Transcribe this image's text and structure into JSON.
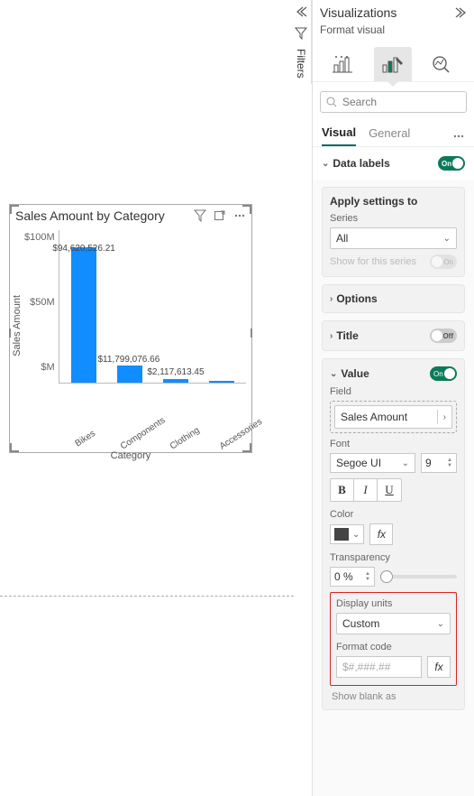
{
  "filters": {
    "label": "Filters"
  },
  "chart": {
    "title": "Sales Amount by Category",
    "y_ticks": [
      "$100M",
      "$50M",
      "$M"
    ],
    "y_label": "Sales Amount",
    "x_label": "Category",
    "data_labels": [
      "$94,620,526.21",
      "$11,799,076.66",
      "$2,117,613.45",
      ""
    ],
    "categories": [
      "Bikes",
      "Components",
      "Clothing",
      "Accessories"
    ]
  },
  "chart_data": {
    "type": "bar",
    "title": "Sales Amount by Category",
    "xlabel": "Category",
    "ylabel": "Sales Amount",
    "ylim": [
      0,
      100000000
    ],
    "categories": [
      "Bikes",
      "Components",
      "Clothing",
      "Accessories"
    ],
    "values": [
      94620526.21,
      11799076.66,
      2117613.45,
      700000
    ]
  },
  "viz": {
    "title": "Visualizations",
    "subtitle": "Format visual",
    "search_placeholder": "Search",
    "tabs": {
      "visual": "Visual",
      "general": "General"
    },
    "data_labels": {
      "label": "Data labels",
      "state": "On"
    },
    "apply": {
      "title": "Apply settings to",
      "series_label": "Series",
      "series_value": "All",
      "show_for_series": "Show for this series",
      "show_state": "On"
    },
    "options": {
      "label": "Options"
    },
    "title_section": {
      "label": "Title",
      "state": "Off"
    },
    "value": {
      "label": "Value",
      "state": "On",
      "field_label": "Field",
      "field_value": "Sales Amount",
      "font_label": "Font",
      "font_name": "Segoe UI",
      "font_size": "9",
      "color_label": "Color",
      "transparency_label": "Transparency",
      "transparency_value": "0 %",
      "display_units_label": "Display units",
      "display_units_value": "Custom",
      "format_code_label": "Format code",
      "format_code_placeholder": "$#,###.##",
      "show_blank_label": "Show blank as"
    }
  }
}
